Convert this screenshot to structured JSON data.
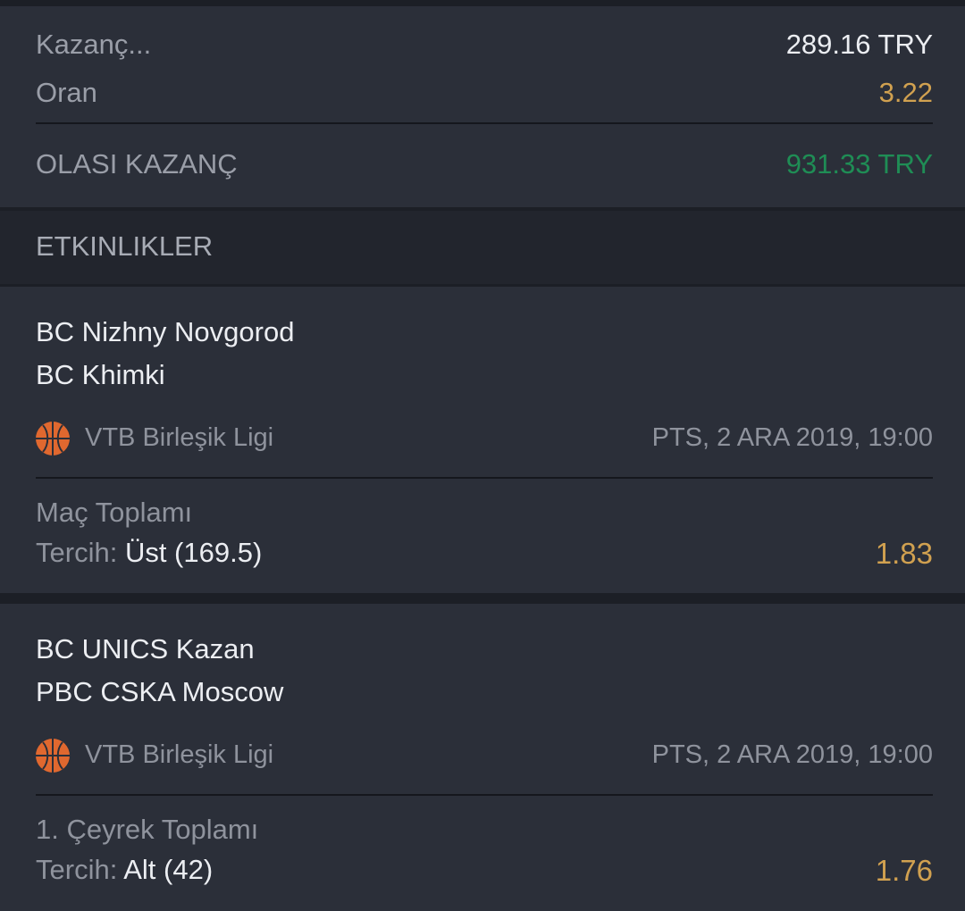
{
  "summary": {
    "stake_label": "Kazanç...",
    "stake_value": "289.16 TRY",
    "odds_label": "Oran",
    "odds_value": "3.22",
    "potential_label": "OLASI KAZANÇ",
    "potential_value": "931.33 TRY"
  },
  "events_header": "ETKINLIKLER",
  "events": [
    {
      "home": "BC Nizhny Novgorod",
      "away": "BC Khimki",
      "sport_icon": "basketball-icon",
      "league": "VTB Birleşik Ligi",
      "datetime": "PTS, 2 ARA 2019, 19:00",
      "market": "Maç Toplamı",
      "pick_label": "Tercih:",
      "pick_value": "Üst (169.5)",
      "odds": "1.83"
    },
    {
      "home": "BC UNICS Kazan",
      "away": "PBC CSKA Moscow",
      "sport_icon": "basketball-icon",
      "league": "VTB Birleşik Ligi",
      "datetime": "PTS, 2 ARA 2019, 19:00",
      "market": "1. Çeyrek Toplamı",
      "pick_label": "Tercih:",
      "pick_value": "Alt (42)",
      "odds": "1.76"
    }
  ],
  "colors": {
    "background": "#1c1f26",
    "card": "#2b2f39",
    "accent_gold": "#d1a150",
    "accent_green": "#1f8d55",
    "basketball_orange": "#e0682f"
  }
}
